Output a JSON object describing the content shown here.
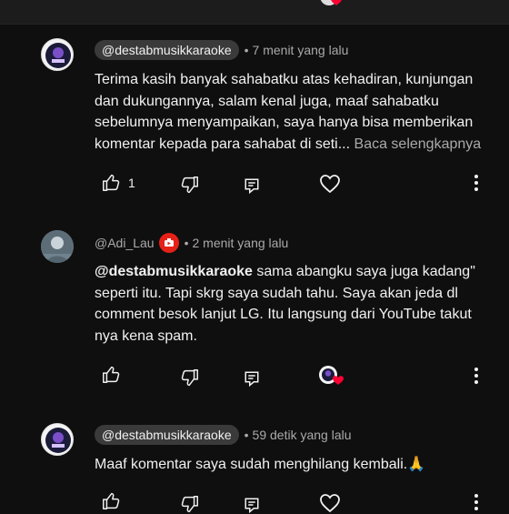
{
  "comments": [
    {
      "handle": "@destabmusikkaraoke",
      "time": "7 menit yang lalu",
      "text": "Terima kasih banyak sahabatku atas kehadiran, kunjungan dan dukungannya, salam kenal juga, maaf sahabatku sebelumnya menyampaikan, saya hanya bisa memberikan komentar kepada para sahabat di seti...",
      "read_more": "Baca selengkapnya",
      "like_count": "1"
    },
    {
      "handle": "@Adi_Lau",
      "time": "2 menit yang lalu",
      "mention": "@destabmusikkaraoke",
      "text": "sama abangku saya juga kadang\" seperti itu. Tapi skrg saya sudah tahu. Saya akan jeda dl comment besok lanjut LG. Itu langsung dari YouTube takut nya kena spam.",
      "like_count": ""
    },
    {
      "handle": "@destabmusikkaraoke",
      "time": "59 detik yang lalu",
      "text": "Maaf komentar saya sudah menghilang kembali.🙏",
      "like_count": ""
    }
  ],
  "separator": "•",
  "icons": {
    "like": "thumb-up-icon",
    "dislike": "thumb-down-icon",
    "reply": "reply-comment-icon",
    "heart": "heart-outline-icon",
    "more": "more-vert-icon",
    "creator_heart": "creator-heart-icon",
    "badge": "youtube-badge-icon"
  },
  "colors": {
    "background": "#0f0f0f",
    "text": "#f1f1f1",
    "secondary": "#aaaaaa",
    "pill": "#3a3a3a",
    "heart_red": "#ff0033"
  }
}
